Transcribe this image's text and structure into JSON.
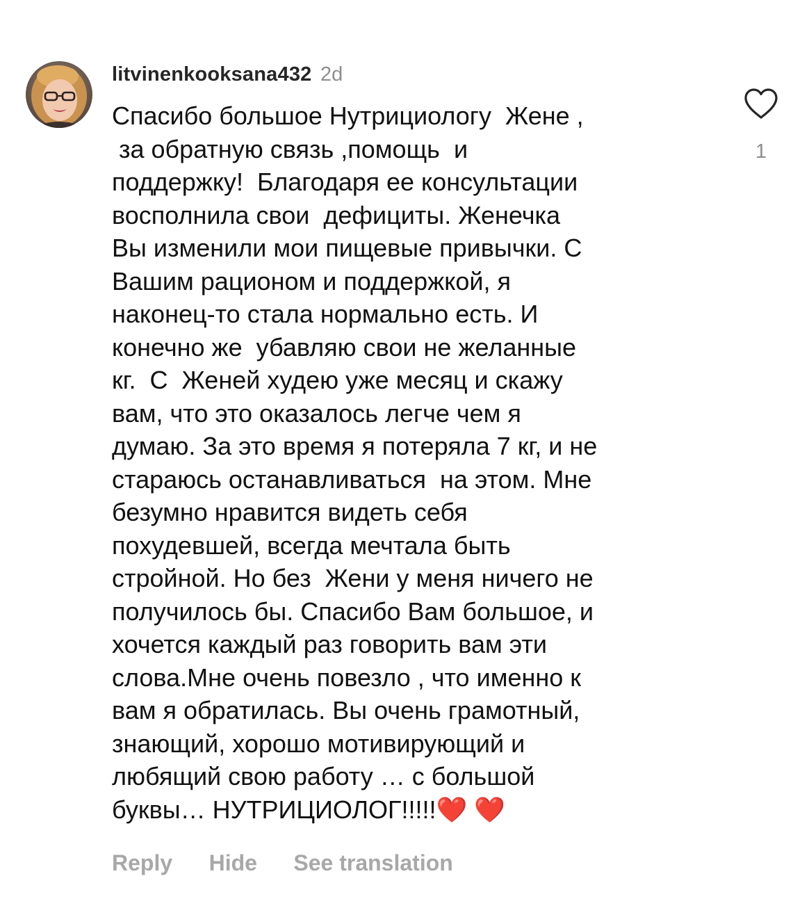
{
  "comment": {
    "username": "litvinenkooksana432",
    "time_ago": "2d",
    "text_lines": [
      "Спасибо большое Нутрициологу  Жене ,",
      " за обратную связь ,помощь  и",
      "поддержку!  Благодаря ее консультации",
      "восполнила свои  дефициты. Женечка",
      "Вы изменили мои пищевые привычки. С",
      "Вашим рационом и поддержкой, я",
      "наконец-то стала нормально есть. И",
      "конечно же  убавляю свои не желанные",
      "кг.  С  Женей худею уже месяц и скажу",
      "вам, что это оказалось легче чем я",
      "думаю. За это время я потеряла 7 кг, и не",
      "стараюсь останавливаться  на этом. Мне",
      "безумно нравится видеть себя",
      "похудевшей, всегда мечтала быть",
      "стройной. Но без  Жени у меня ничего не",
      "получилось бы. Спасибо Вам большое, и",
      "хочется каждый раз говорить вам эти",
      "слова.Мне очень повезло , что именно к",
      "вам я обратилась. Вы очень грамотный,",
      "знающий, хорошо мотивирующий и",
      "любящий свою работу … с большой",
      "буквы… НУТРИЦИОЛОГ!!!!!❤️ ❤️"
    ],
    "like_count": "1",
    "actions": {
      "reply": "Reply",
      "hide": "Hide",
      "translate": "See translation"
    }
  },
  "icons": {
    "like": "heart-outline-icon",
    "avatar": "user-avatar-photo"
  },
  "colors": {
    "primary_text": "#111111",
    "username": "#262626",
    "muted": "#8e8e8e",
    "action": "#a8a8a8",
    "heart_emoji": "#e8202e"
  }
}
